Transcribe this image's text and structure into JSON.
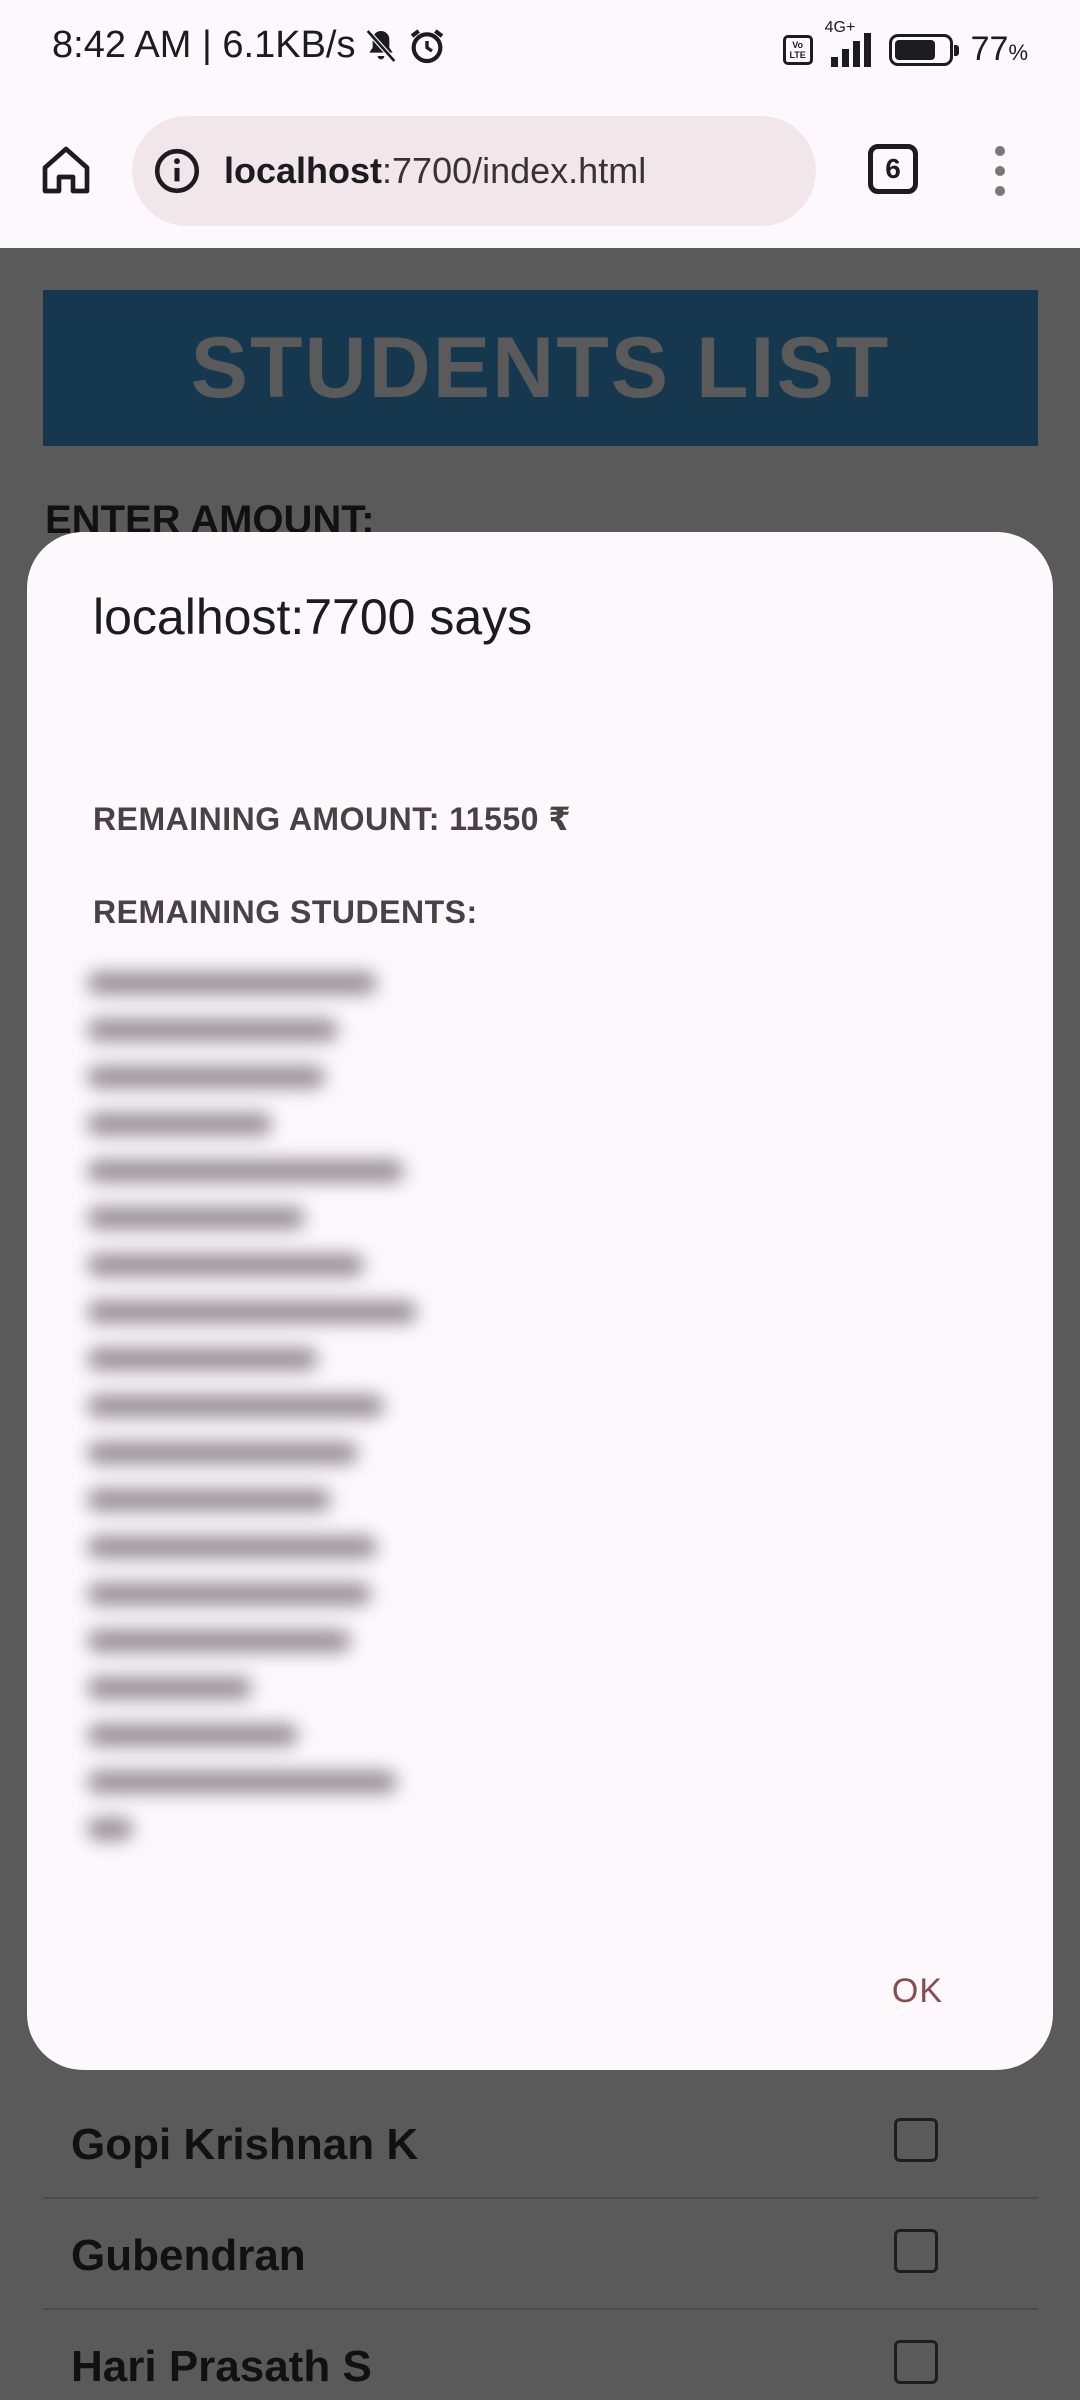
{
  "status_bar": {
    "time_network": "8:42 AM | 6.1KB/s",
    "network_type": "4G+",
    "battery_percent": "77",
    "battery_unit": "%"
  },
  "browser": {
    "url_host": "localhost",
    "url_rest": ":7700/index.html",
    "tab_count": "6"
  },
  "page": {
    "heading": "STUDENTS LIST",
    "enter_amount_label": "ENTER AMOUNT:",
    "students": [
      {
        "name": "Gopi Krishnan K"
      },
      {
        "name": "Gubendran"
      },
      {
        "name": "Hari Prasath S"
      }
    ]
  },
  "dialog": {
    "title": "localhost:7700 says",
    "remaining_amount": "REMAINING AMOUNT: 11550 ₹",
    "remaining_students": "REMAINING STUDENTS:",
    "ok_label": "OK"
  },
  "colors": {
    "heading_bg": "#15384f",
    "dialog_bg": "#fdf8fb",
    "ok_text": "#8a4a50"
  }
}
